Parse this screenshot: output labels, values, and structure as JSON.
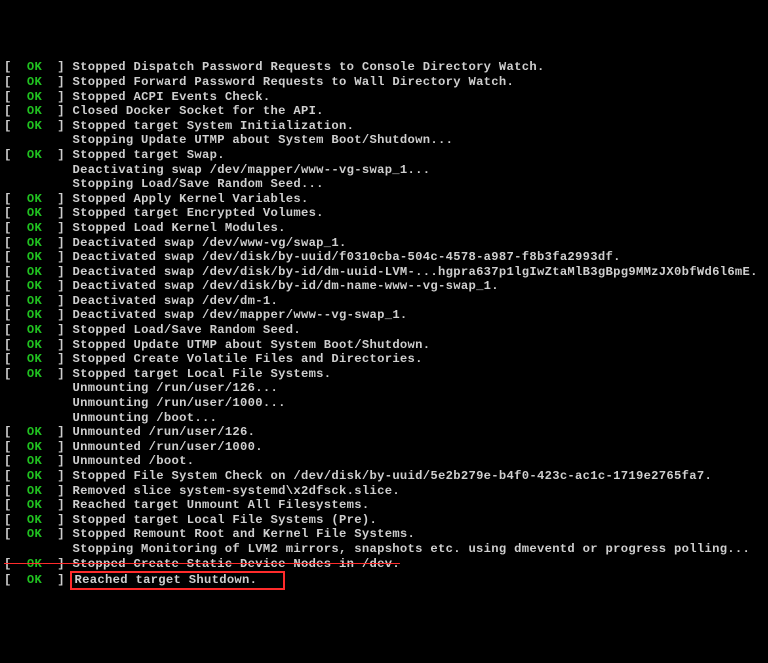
{
  "colors": {
    "ok": "#20c020",
    "text": "#cfcfcf",
    "highlight": "#ff2b2b"
  },
  "labels": {
    "ok": "OK"
  },
  "lines": [
    {
      "type": "ok",
      "text": "Stopped Dispatch Password Requests to Console Directory Watch."
    },
    {
      "type": "ok",
      "text": "Stopped Forward Password Requests to Wall Directory Watch."
    },
    {
      "type": "ok",
      "text": "Stopped ACPI Events Check."
    },
    {
      "type": "ok",
      "text": "Closed Docker Socket for the API."
    },
    {
      "type": "ok",
      "text": "Stopped target System Initialization."
    },
    {
      "type": "plain",
      "text": "Stopping Update UTMP about System Boot/Shutdown..."
    },
    {
      "type": "ok",
      "text": "Stopped target Swap."
    },
    {
      "type": "plain",
      "text": "Deactivating swap /dev/mapper/www--vg-swap_1..."
    },
    {
      "type": "plain",
      "text": "Stopping Load/Save Random Seed..."
    },
    {
      "type": "ok",
      "text": "Stopped Apply Kernel Variables."
    },
    {
      "type": "ok",
      "text": "Stopped target Encrypted Volumes."
    },
    {
      "type": "ok",
      "text": "Stopped Load Kernel Modules."
    },
    {
      "type": "ok",
      "text": "Deactivated swap /dev/www-vg/swap_1."
    },
    {
      "type": "ok",
      "text": "Deactivated swap /dev/disk/by-uuid/f0310cba-504c-4578-a987-f8b3fa2993df."
    },
    {
      "type": "ok",
      "text": "Deactivated swap /dev/disk/by-id/dm-uuid-LVM-...hgpra637p1lgIwZtaMlB3gBpg9MMzJX0bfWd6l6mE."
    },
    {
      "type": "ok",
      "text": "Deactivated swap /dev/disk/by-id/dm-name-www--vg-swap_1."
    },
    {
      "type": "ok",
      "text": "Deactivated swap /dev/dm-1."
    },
    {
      "type": "ok",
      "text": "Deactivated swap /dev/mapper/www--vg-swap_1."
    },
    {
      "type": "ok",
      "text": "Stopped Load/Save Random Seed."
    },
    {
      "type": "ok",
      "text": "Stopped Update UTMP about System Boot/Shutdown."
    },
    {
      "type": "ok",
      "text": "Stopped Create Volatile Files and Directories."
    },
    {
      "type": "ok",
      "text": "Stopped target Local File Systems."
    },
    {
      "type": "plain",
      "text": "Unmounting /run/user/126..."
    },
    {
      "type": "plain",
      "text": "Unmounting /run/user/1000..."
    },
    {
      "type": "plain",
      "text": "Unmounting /boot..."
    },
    {
      "type": "ok",
      "text": "Unmounted /run/user/126."
    },
    {
      "type": "ok",
      "text": "Unmounted /run/user/1000."
    },
    {
      "type": "ok",
      "text": "Unmounted /boot."
    },
    {
      "type": "ok",
      "text": "Stopped File System Check on /dev/disk/by-uuid/5e2b279e-b4f0-423c-ac1c-1719e2765fa7."
    },
    {
      "type": "ok",
      "text": "Removed slice system-systemd\\x2dfsck.slice."
    },
    {
      "type": "ok",
      "text": "Reached target Unmount All Filesystems."
    },
    {
      "type": "ok",
      "text": "Stopped target Local File Systems (Pre)."
    },
    {
      "type": "ok",
      "text": "Stopped Remount Root and Kernel File Systems."
    },
    {
      "type": "plain",
      "text": "Stopping Monitoring of LVM2 mirrors, snapshots etc. using dmeventd or progress polling..."
    },
    {
      "type": "ok",
      "strike": true,
      "text": "Stopped Create Static Device Nodes in /dev."
    },
    {
      "type": "ok",
      "highlight": true,
      "text": "Reached target Shutdown."
    }
  ]
}
